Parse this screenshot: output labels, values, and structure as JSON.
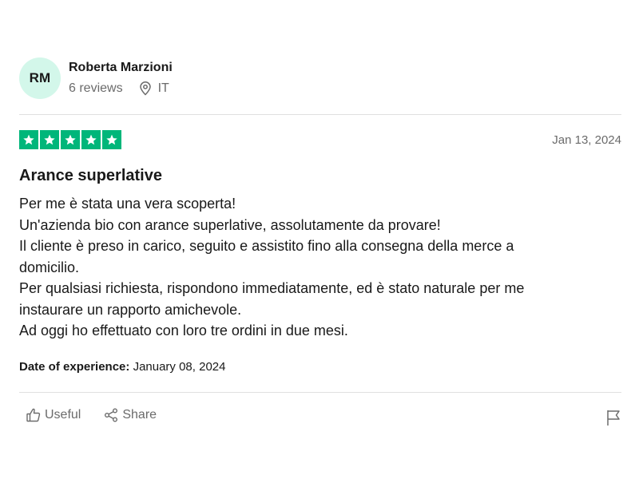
{
  "reviewer": {
    "initials": "RM",
    "name": "Roberta Marzioni",
    "reviews_count": "6 reviews",
    "country": "IT",
    "avatar_color": "#d3f7ea"
  },
  "review": {
    "rating": 5,
    "max_rating": 5,
    "star_color": "#00b67a",
    "date": "Jan 13, 2024",
    "title": "Arance superlative",
    "body_lines": [
      "Per me è stata una vera scoperta!",
      "Un'azienda bio con arance superlative, assolutamente da provare!",
      "Il cliente è preso in carico, seguito e assistito fino alla consegna della merce a",
      "domicilio.",
      "Per qualsiasi richiesta, rispondono immediatamente, ed è stato naturale per me",
      "instaurare un rapporto amichevole.",
      "Ad oggi ho effettuato con loro tre ordini in due mesi."
    ],
    "experience_label": "Date of experience:",
    "experience_date": "January 08, 2024"
  },
  "actions": {
    "useful_label": "Useful",
    "useful_icon": "thumbs-up-icon",
    "share_label": "Share",
    "share_icon": "share-icon",
    "report_icon": "flag-icon"
  }
}
